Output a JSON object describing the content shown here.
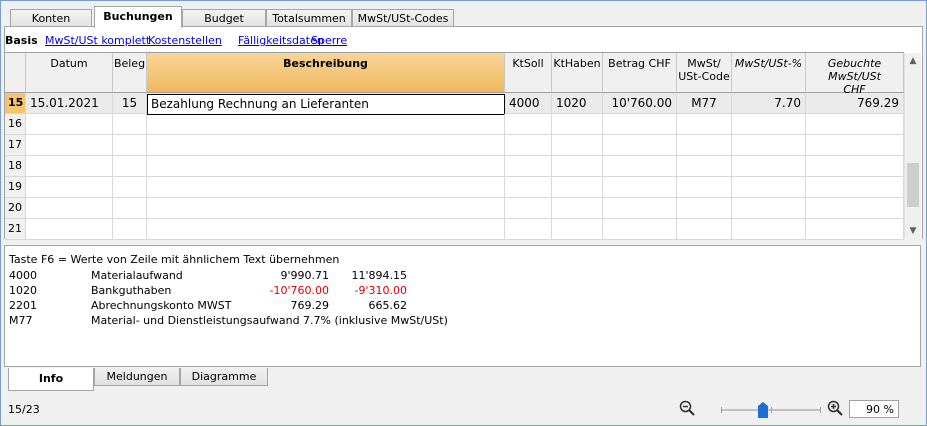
{
  "tabs": [
    "Konten",
    "Buchungen",
    "Budget",
    "Totalsummen",
    "MwSt/USt-Codes"
  ],
  "views": {
    "current": "Basis",
    "links": [
      "MwSt/USt komplett",
      "Kostenstellen",
      "Fälligkeitsdaten",
      "Sperre"
    ]
  },
  "columns": {
    "datum": "Datum",
    "beleg": "Beleg",
    "beschreibung": "Beschreibung",
    "ktsoll": "KtSoll",
    "kthaben": "KtHaben",
    "betrag": "Betrag CHF",
    "mwst_line1": "MwSt/",
    "mwst_line2": "USt-Code",
    "ust_pct": "MwSt/USt-%",
    "gebucht_line1": "Gebuchte MwSt/USt",
    "gebucht_line2": "CHF"
  },
  "rows": [
    {
      "n": "15",
      "datum": "15.01.2021",
      "beleg": "15",
      "beschreibung": "Bezahlung Rechnung an Lieferanten",
      "ktsoll": "4000",
      "kthaben": "1020",
      "betrag": "10'760.00",
      "mwst": "M77",
      "ust_pct": "7.70",
      "gebucht": "769.29"
    },
    {
      "n": "16"
    },
    {
      "n": "17"
    },
    {
      "n": "18"
    },
    {
      "n": "19"
    },
    {
      "n": "20"
    },
    {
      "n": "21"
    }
  ],
  "info": {
    "hint": "Taste F6 = Werte von Zeile mit ähnlichem Text übernehmen",
    "lines": [
      {
        "code": "4000",
        "name": "Materialaufwand",
        "v1": "9'990.71",
        "v2": "11'894.15"
      },
      {
        "code": "1020",
        "name": "Bankguthaben",
        "v1": "-10'760.00",
        "v2": "-9'310.00"
      },
      {
        "code": "2201",
        "name": "Abrechnungskonto MWST",
        "v1": "769.29",
        "v2": "665.62"
      },
      {
        "code": "M77",
        "name": "Material- und Dienstleistungsaufwand 7.7% (inklusive MwSt/USt)"
      }
    ]
  },
  "bottom_tabs": [
    "Info",
    "Meldungen",
    "Diagramme"
  ],
  "status": "15/23",
  "zoom": {
    "value": "90",
    "unit": "%"
  },
  "colors": {
    "accent": "#f6c46a",
    "negative": "#e00000",
    "link": "#0000e0"
  }
}
